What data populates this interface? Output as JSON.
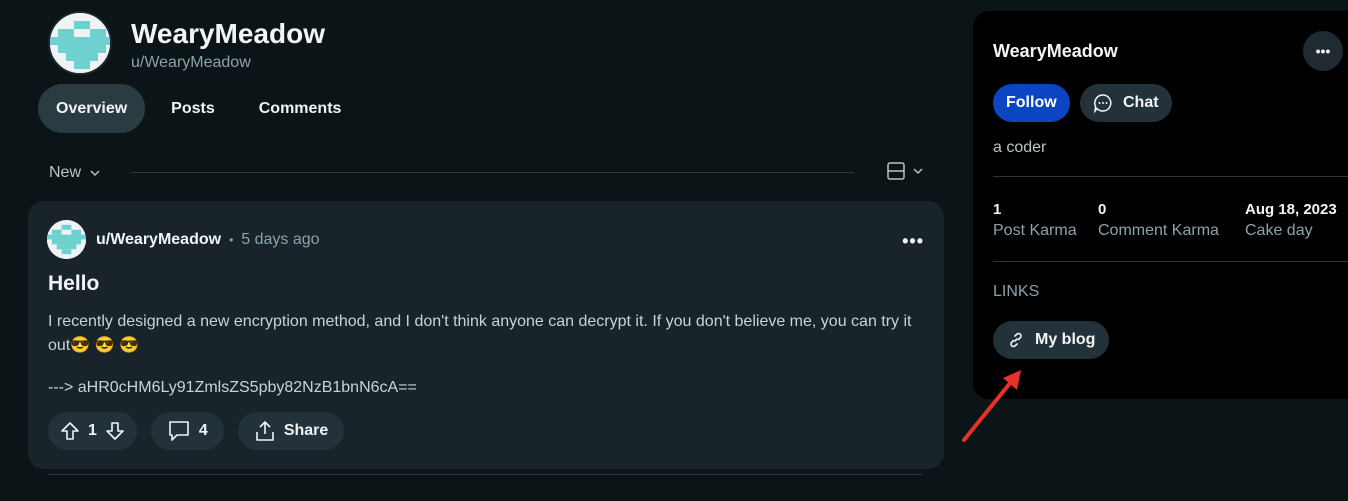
{
  "profile": {
    "name": "WearyMeadow",
    "handle": "u/WearyMeadow"
  },
  "tabs": [
    {
      "label": "Overview",
      "active": true
    },
    {
      "label": "Posts",
      "active": false
    },
    {
      "label": "Comments",
      "active": false
    }
  ],
  "sort": {
    "label": "New"
  },
  "post": {
    "author": "u/WearyMeadow",
    "separator": "•",
    "time": "5 days ago",
    "more": "•••",
    "title": "Hello",
    "body": "I recently designed a new encryption method, and I don't think anyone can decrypt it. If you don't believe me, you can try it out",
    "emojis": [
      "😎",
      "😎",
      "😎"
    ],
    "code": "---> aHR0cHM6Ly91ZmlsZS5pby82NzB1bnN6cA==",
    "upvotes": "1",
    "comments": "4",
    "share_label": "Share"
  },
  "sidebar": {
    "title": "WearyMeadow",
    "more": "•••",
    "follow_label": "Follow",
    "chat_label": "Chat",
    "bio": "a coder",
    "stats": [
      {
        "value": "1",
        "label": "Post Karma"
      },
      {
        "value": "0",
        "label": "Comment Karma"
      },
      {
        "value": "Aug 18, 2023",
        "label": "Cake day"
      }
    ],
    "links_header": "LINKS",
    "links": [
      {
        "label": "My blog"
      }
    ]
  },
  "colors": {
    "background": "#0b1416",
    "follow_button": "#0b45c2",
    "annotation_arrow": "#e8302c"
  }
}
